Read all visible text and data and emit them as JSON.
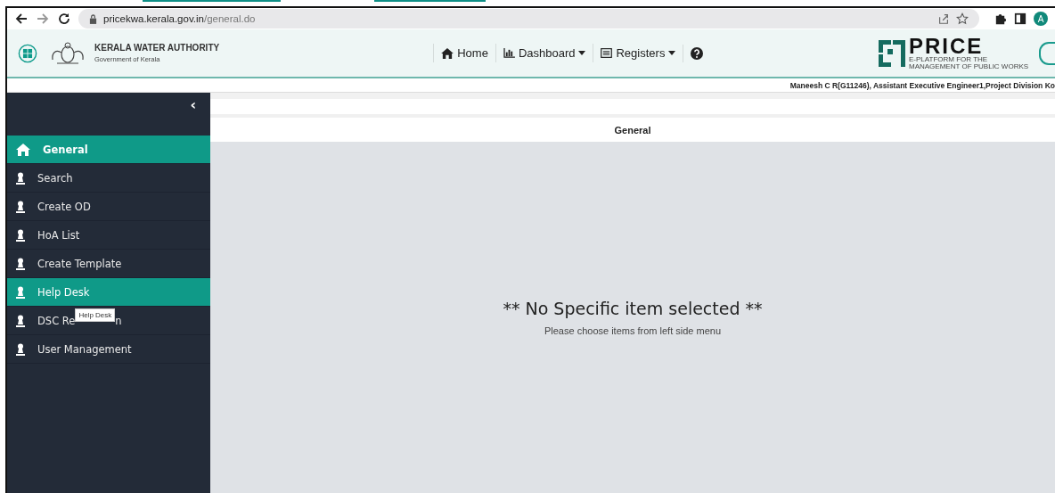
{
  "browser": {
    "url_host": "pricekwa.kerala.gov.in",
    "url_path": "/general.do",
    "profile_initial": "A"
  },
  "header": {
    "org_name": "KERALA WATER AUTHORITY",
    "org_sub": "Government of Kerala",
    "nav": [
      {
        "label": "Home",
        "kind": "home"
      },
      {
        "label": "Dashboard",
        "kind": "dashboard"
      },
      {
        "label": "Registers",
        "kind": "registers"
      },
      {
        "kind": "help"
      }
    ],
    "logo_text": "PRICE",
    "logo_tagline": "E-PLATFORM FOR THE MANAGEMENT OF PUBLIC WORKS"
  },
  "user_info": "Maneesh C R(G11246), Assistant Executive Engineer1,Project Division Ko",
  "sidebar": {
    "collapse": "‹",
    "items": [
      {
        "label": "General",
        "kind": "home",
        "selected": true,
        "hovered": false
      },
      {
        "label": "Search",
        "kind": "user",
        "selected": false,
        "hovered": false
      },
      {
        "label": "Create OD",
        "kind": "user",
        "selected": false,
        "hovered": false
      },
      {
        "label": "HoA List",
        "kind": "user",
        "selected": false,
        "hovered": false
      },
      {
        "label": "Create Template",
        "kind": "user",
        "selected": false,
        "hovered": false
      },
      {
        "label": "Help Desk",
        "kind": "user",
        "selected": false,
        "hovered": true
      },
      {
        "label": "DSC Re",
        "label_tail": "n",
        "tooltip": "Help Desk",
        "kind": "user",
        "selected": false,
        "hovered": false
      },
      {
        "label": "User Management",
        "kind": "user",
        "selected": false,
        "hovered": false
      }
    ]
  },
  "page_title": "General",
  "empty_state": {
    "title": "** No Specific item selected **",
    "hint": "Please choose items from left side menu"
  }
}
